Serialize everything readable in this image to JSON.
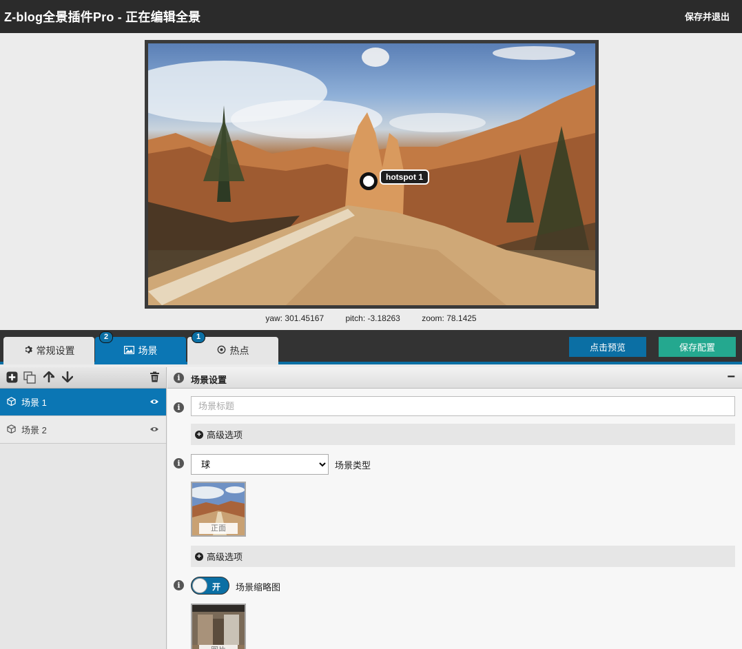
{
  "header": {
    "title": "Z-blog全景插件Pro - 正在编辑全景",
    "exit_label": "保存并退出"
  },
  "viewer": {
    "hotspot_label": "hotspot 1",
    "yaw_text": "yaw: 301.45167",
    "pitch_text": "pitch: -3.18263",
    "zoom_text": "zoom: 78.1425"
  },
  "tabs": [
    {
      "label": "常规设置",
      "icon": "gear-icon",
      "badge": ""
    },
    {
      "label": "场景",
      "icon": "image-icon",
      "badge": "2"
    },
    {
      "label": "热点",
      "icon": "target-icon",
      "badge": "1"
    }
  ],
  "actions": {
    "preview_label": "点击预览",
    "save_label": "保存配置"
  },
  "sidebar": {
    "scenes": [
      {
        "label": "场景 1",
        "active": true
      },
      {
        "label": "场景 2",
        "active": false
      }
    ]
  },
  "scene_settings": {
    "section_title": "场景设置",
    "title_placeholder": "场景标题",
    "advanced_label": "高级选项",
    "type_value": "球",
    "type_label": "场景类型",
    "face_caption": "正面",
    "advanced_label_2": "高级选项",
    "toggle_text": "开",
    "thumbnail_label": "场景缩略图",
    "thumb_caption": "图片"
  },
  "colors": {
    "accent": "#0b76b4",
    "save": "#24a88f",
    "topbar": "#2b2b2b"
  }
}
